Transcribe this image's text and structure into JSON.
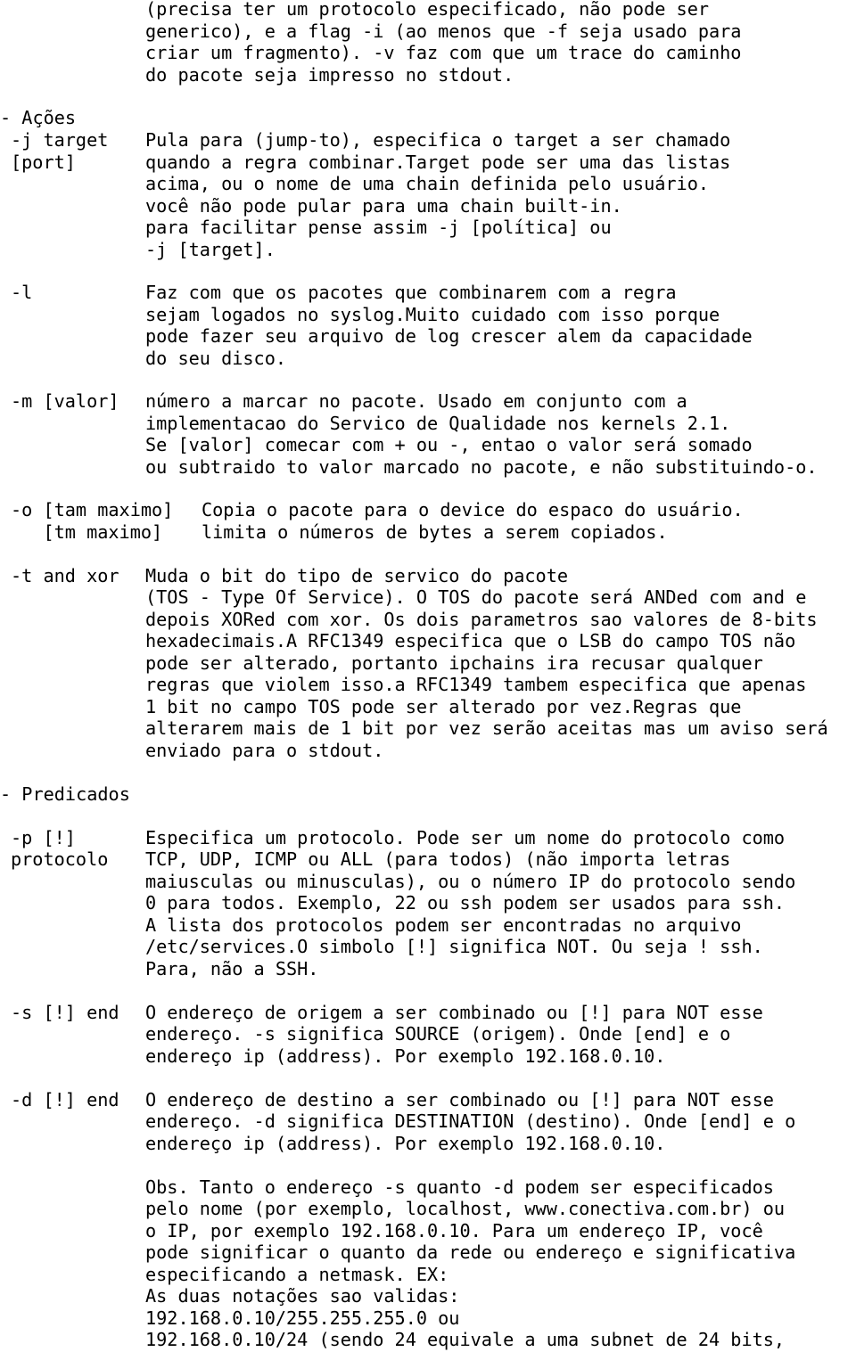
{
  "intro": {
    "lines": [
      "(precisa ter um protocolo especificado, não pode ser",
      "generico), e a flag -i (ao menos que -f seja usado para",
      "criar um fragmento). -v faz com que um trace do caminho",
      "do pacote seja impresso no stdout."
    ]
  },
  "acoes": {
    "heading": "- Ações",
    "j": {
      "term": [
        "-j target",
        "[port]"
      ],
      "desc": [
        "Pula para (jump-to), especifica o target a ser chamado",
        "quando a regra combinar.Target pode ser uma das listas",
        "acima, ou o nome de uma chain definida pelo usuário.",
        "você não pode pular para uma chain built-in.",
        "para facilitar pense assim -j [política] ou",
        "-j [target]."
      ]
    },
    "l": {
      "term": [
        "-l"
      ],
      "desc": [
        "Faz com que os pacotes que combinarem com a regra",
        "sejam logados no syslog.Muito cuidado com isso porque",
        "pode fazer seu arquivo de log crescer alem da capacidade",
        "do seu disco."
      ]
    },
    "m": {
      "term": [
        "-m [valor]"
      ],
      "desc": [
        "número a marcar no pacote. Usado em conjunto com a",
        "implementacao do Servico de Qualidade nos kernels 2.1.",
        "Se [valor] comecar com + ou -, entao o valor será somado",
        "ou subtraido to valor marcado no pacote, e não substituindo-o."
      ]
    },
    "o": {
      "term": [
        "-o [tam maximo]",
        "   [tm maximo]"
      ],
      "desc": [
        "Copia o pacote para o device do espaco do usuário.",
        "limita o números de bytes a serem copiados."
      ]
    },
    "t": {
      "term": [
        "-t and xor"
      ],
      "desc": [
        "Muda o bit do tipo de servico do pacote",
        "(TOS - Type Of Service). O TOS do pacote será ANDed com and e",
        "depois XORed com xor. Os dois parametros sao valores de 8-bits",
        "hexadecimais.A RFC1349 especifica que o LSB do campo TOS não",
        "pode ser alterado, portanto ipchains ira recusar qualquer",
        "regras que violem isso.a RFC1349 tambem especifica que apenas",
        "1 bit no campo TOS pode ser alterado por vez.Regras que",
        "alterarem mais de 1 bit por vez serão aceitas mas um aviso será",
        "enviado para o stdout."
      ]
    }
  },
  "predicados": {
    "heading": "- Predicados",
    "p": {
      "term": [
        "-p [!]",
        "protocolo"
      ],
      "desc": [
        "Especifica um protocolo. Pode ser um nome do protocolo como",
        "TCP, UDP, ICMP ou ALL (para todos) (não importa letras",
        "maiusculas ou minusculas), ou o número IP do protocolo sendo",
        "0 para todos. Exemplo, 22 ou ssh podem ser usados para ssh.",
        "A lista dos protocolos podem ser encontradas no arquivo",
        "/etc/services.O simbolo [!] significa NOT. Ou seja ! ssh.",
        "Para, não a SSH."
      ]
    },
    "s": {
      "term": [
        "-s [!] end"
      ],
      "desc": [
        "O endereço de origem a ser combinado ou [!] para NOT esse",
        "endereço. -s significa SOURCE (origem). Onde [end] e o",
        "endereço ip (address). Por exemplo 192.168.0.10."
      ]
    },
    "d": {
      "term": [
        "-d [!] end"
      ],
      "desc": [
        "O endereço de destino a ser combinado ou [!] para NOT esse",
        "endereço. -d significa DESTINATION (destino). Onde [end] e o",
        "endereço ip (address). Por exemplo 192.168.0.10."
      ]
    },
    "obs": {
      "lines": [
        "Obs. Tanto o endereço -s quanto -d podem ser especificados",
        "pelo nome (por exemplo, localhost, www.conectiva.com.br) ou",
        "o IP, por exemplo 192.168.0.10. Para um endereço IP, você",
        "pode significar o quanto da rede ou endereço e significativa",
        "especificando a netmask. EX:",
        "As duas notações sao validas:",
        "192.168.0.10/255.255.255.0 ou",
        "192.168.0.10/24 (sendo 24 equivale a uma subnet de 24 bits,"
      ]
    }
  }
}
